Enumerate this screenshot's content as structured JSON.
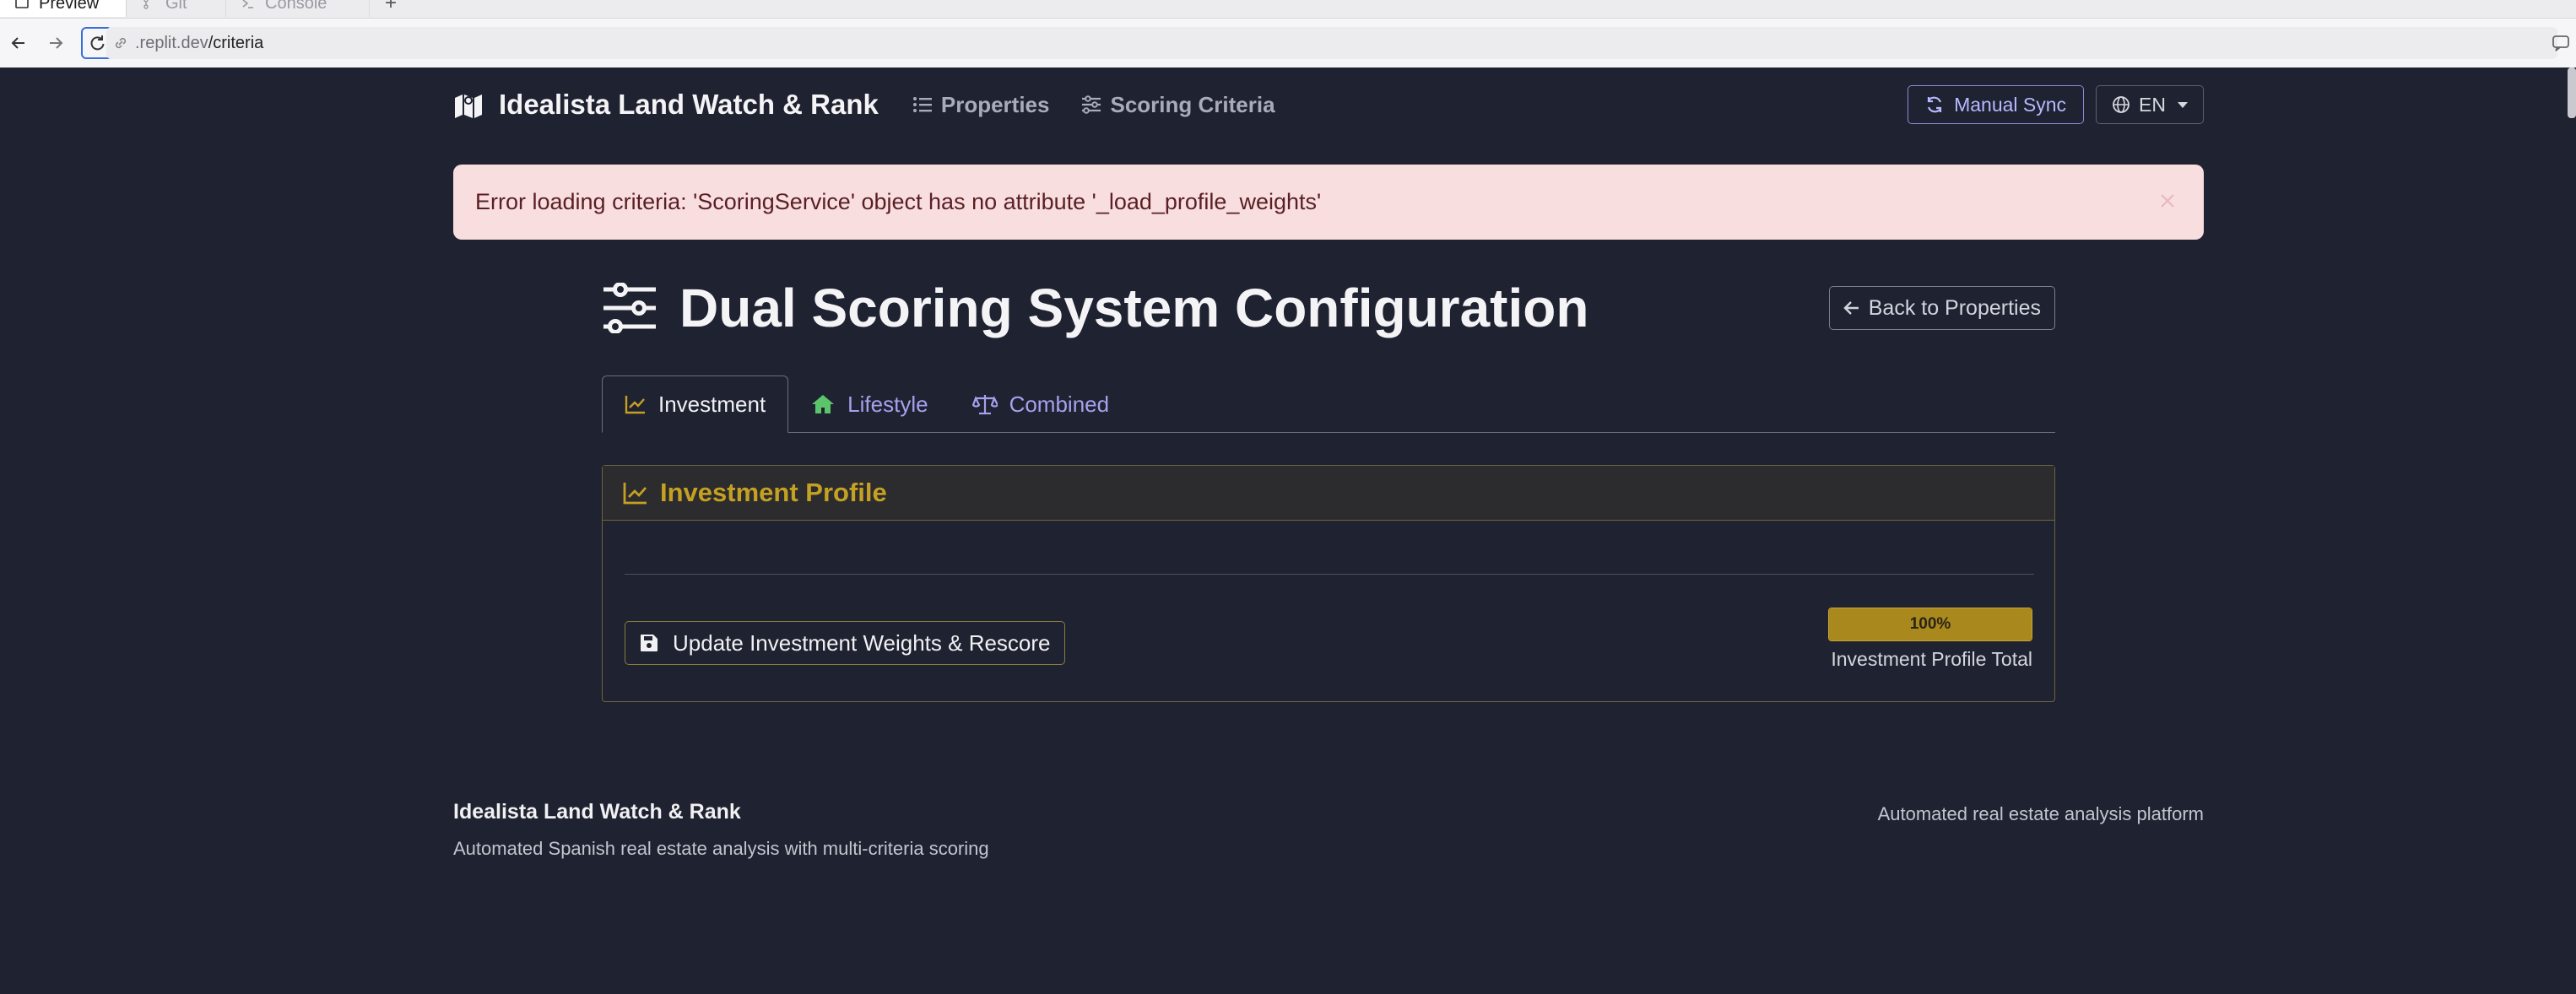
{
  "browser": {
    "tabs": [
      {
        "label": "Preview",
        "active": true
      },
      {
        "label": "Git",
        "active": false
      },
      {
        "label": "Console",
        "active": false
      }
    ],
    "new_tab": "+",
    "url_muted": ".replit.dev",
    "url_path": "/criteria"
  },
  "navbar": {
    "brand": "Idealista Land Watch & Rank",
    "brand_icon": "map-icon",
    "links": [
      {
        "label": "Properties",
        "icon": "list-icon"
      },
      {
        "label": "Scoring Criteria",
        "icon": "sliders-icon"
      }
    ],
    "sync_label": "Manual Sync",
    "lang_label": "EN"
  },
  "alert": {
    "message": "Error loading criteria: 'ScoringService' object has no attribute '_load_profile_weights'"
  },
  "page": {
    "title": "Dual Scoring System Configuration",
    "back_label": "Back to Properties",
    "tabs": [
      {
        "label": "Investment",
        "icon": "chart-line-icon",
        "active": true
      },
      {
        "label": "Lifestyle",
        "icon": "home-icon",
        "active": false
      },
      {
        "label": "Combined",
        "icon": "balance-scale-icon",
        "active": false
      }
    ]
  },
  "card": {
    "title": "Investment Profile",
    "update_label": "Update Investment Weights & Rescore",
    "progress_percent": 100,
    "progress_text": "100%",
    "total_label": "Investment Profile Total"
  },
  "footer": {
    "title": "Idealista Land Watch & Rank",
    "subtitle": "Automated Spanish real estate analysis with multi-criteria scoring",
    "right": "Automated real estate analysis platform"
  },
  "colors": {
    "background": "#1f2230",
    "accent_gold": "#c4a122",
    "accent_purple": "#a6a1ee",
    "lifestyle_green": "#5cc46a",
    "alert_bg": "#f8dedf"
  }
}
